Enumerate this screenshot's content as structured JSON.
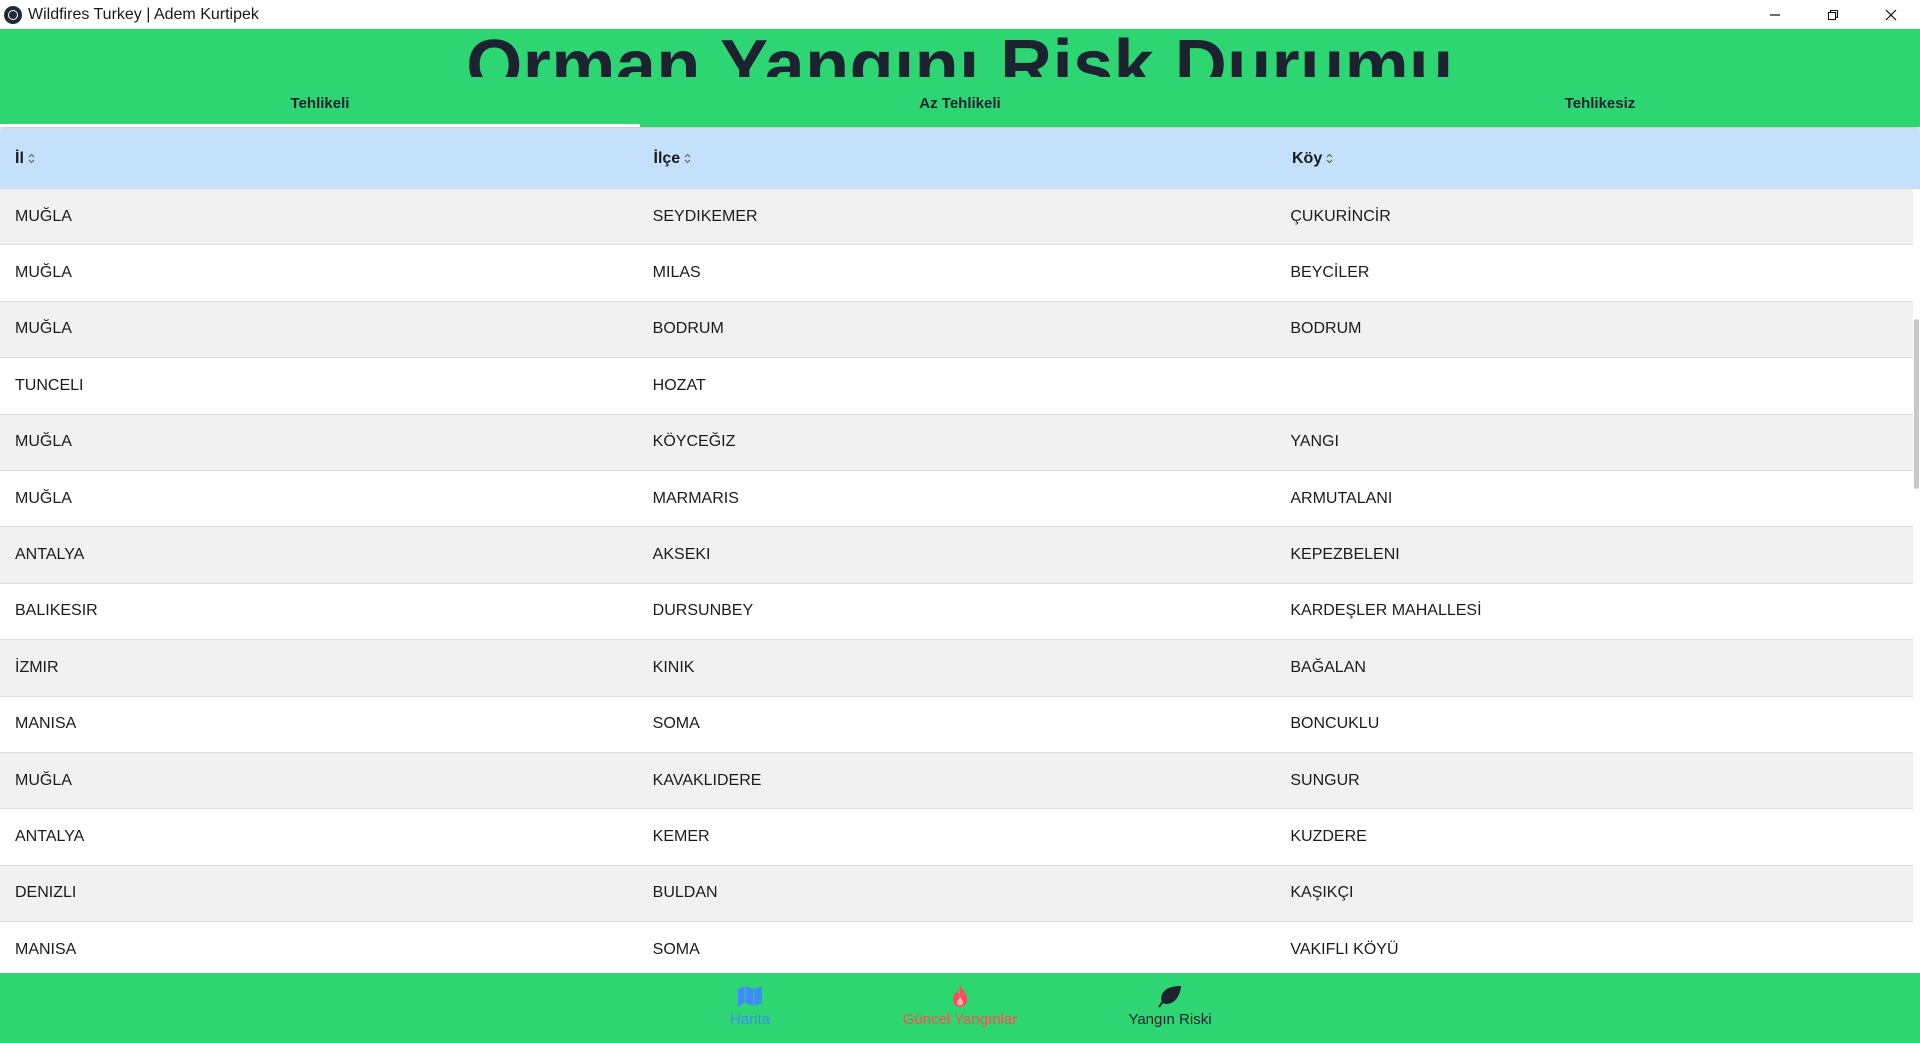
{
  "window": {
    "title": "Wildfires Turkey | Adem Kurtipek",
    "controls": [
      "minimize",
      "restore",
      "close"
    ]
  },
  "header": {
    "title": "Orman Yangını Risk Durumu",
    "tabs": [
      {
        "label": "Tehlikeli",
        "active": true
      },
      {
        "label": "Az Tehlikeli",
        "active": false
      },
      {
        "label": "Tehlikesiz",
        "active": false
      }
    ]
  },
  "table": {
    "columns": [
      "İl",
      "İlçe",
      "Köy"
    ],
    "rows": [
      [
        "MUĞLA",
        "SEYDIKEMER",
        "ÇUKURİNCİR"
      ],
      [
        "MUĞLA",
        "MILAS",
        "BEYCİLER"
      ],
      [
        "MUĞLA",
        "BODRUM",
        "BODRUM"
      ],
      [
        "TUNCELI",
        "HOZAT",
        ""
      ],
      [
        "MUĞLA",
        "KÖYCEĞIZ",
        "YANGI"
      ],
      [
        "MUĞLA",
        "MARMARIS",
        "ARMUTALANI"
      ],
      [
        "ANTALYA",
        "AKSEKI",
        "KEPEZBELENI"
      ],
      [
        "BALIKESIR",
        "DURSUNBEY",
        "KARDEŞLER MAHALLESİ"
      ],
      [
        "İZMIR",
        "KINIK",
        "BAĞALAN"
      ],
      [
        "MANISA",
        "SOMA",
        "BONCUKLU"
      ],
      [
        "MUĞLA",
        "KAVAKLIDERE",
        "SUNGUR"
      ],
      [
        "ANTALYA",
        "KEMER",
        "KUZDERE"
      ],
      [
        "DENIZLI",
        "BULDAN",
        "KAŞIKÇI"
      ],
      [
        "MANISA",
        "SOMA",
        "VAKIFLI KÖYÜ"
      ]
    ]
  },
  "bottom_nav": {
    "items": [
      {
        "label": "Harita",
        "icon": "map-icon",
        "color": "#3d8bfd"
      },
      {
        "label": "Güncel Yangınlar",
        "icon": "fire-icon",
        "color": "#ff4d5a"
      },
      {
        "label": "Yangın Riski",
        "icon": "leaf-icon",
        "color": "#1c2230"
      }
    ]
  },
  "colors": {
    "header_green": "#2ed573",
    "table_header_blue": "#c4e1fb",
    "row_alt": "#f1f1f1"
  }
}
